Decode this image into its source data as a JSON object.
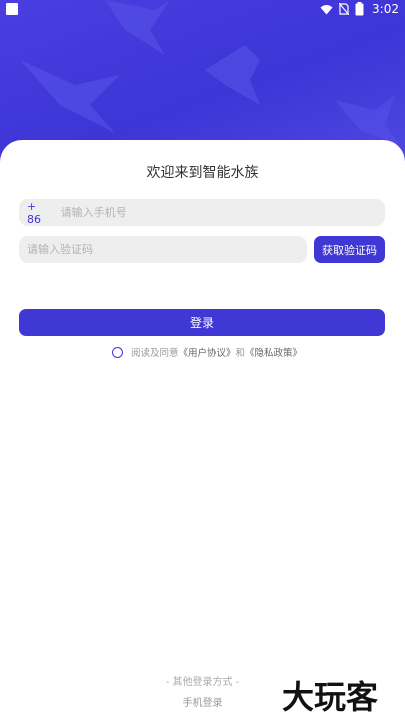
{
  "status_bar": {
    "time": "3:02",
    "battery_level": "2"
  },
  "title": "欢迎来到智能水族",
  "phone": {
    "prefix": "+ 86",
    "placeholder": "请输入手机号"
  },
  "code": {
    "placeholder": "请输入验证码",
    "button_label": "获取验证码"
  },
  "login_button": "登录",
  "agreement": {
    "prefix": "阅读及同意",
    "user_agreement": "《用户协议》",
    "and": "和",
    "privacy_policy": "《隐私政策》"
  },
  "other_login": "- 其他登录方式 -",
  "phone_login": "手机登录",
  "watermark": "大玩客",
  "colors": {
    "accent": "#4038d4",
    "hero": "#4a3ee0"
  }
}
